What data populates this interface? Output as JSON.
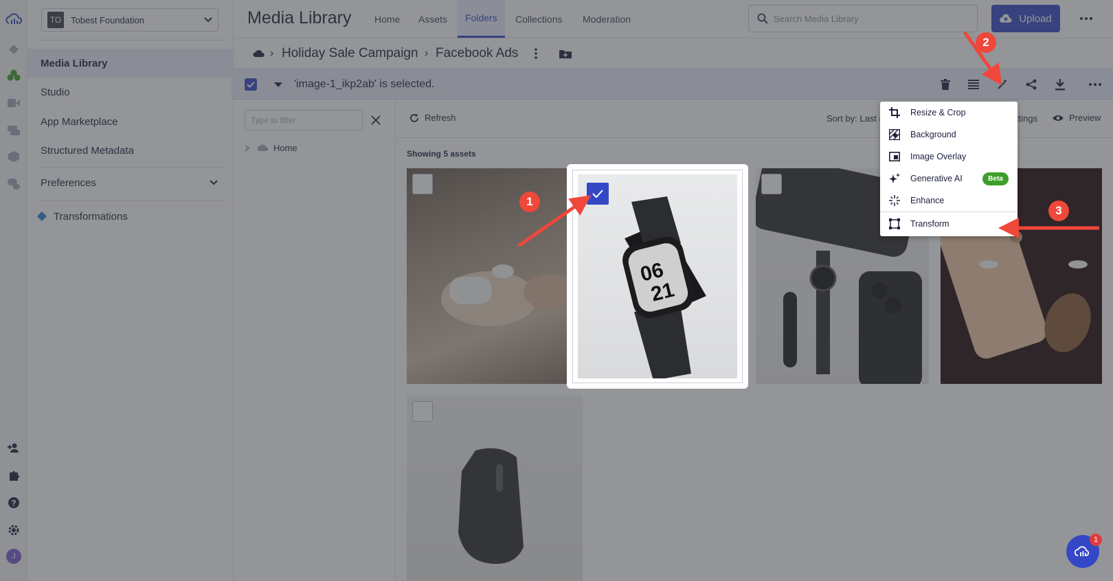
{
  "account": {
    "badge": "TO",
    "name": "Tobest Foundation"
  },
  "nav": {
    "items": [
      {
        "label": "Media Library"
      },
      {
        "label": "Studio"
      },
      {
        "label": "App Marketplace"
      },
      {
        "label": "Structured Metadata"
      },
      {
        "label": "Preferences"
      },
      {
        "label": "Transformations"
      }
    ]
  },
  "header": {
    "title": "Media Library",
    "tabs": [
      "Home",
      "Assets",
      "Folders",
      "Collections",
      "Moderation"
    ],
    "active_tab": "Folders",
    "search_placeholder": "Search Media Library",
    "upload_label": "Upload"
  },
  "breadcrumb": {
    "folder": "Holiday Sale Campaign",
    "subfolder": "Facebook Ads"
  },
  "selection": {
    "text": "'image-1_ikp2ab' is selected."
  },
  "filter": {
    "placeholder": "Type to filter",
    "tree_root": "Home"
  },
  "toolbar": {
    "refresh_label": "Refresh",
    "sort_label": "Sort by: Last m",
    "settings_label": "ttings",
    "preview_label": "Preview",
    "showing": "Showing 5 assets"
  },
  "menu": {
    "items": [
      {
        "label": "Resize & Crop",
        "icon": "crop-icon"
      },
      {
        "label": "Background",
        "icon": "background-icon"
      },
      {
        "label": "Image Overlay",
        "icon": "image-overlay-icon"
      },
      {
        "label": "Generative AI",
        "icon": "sparkle-icon",
        "badge": "Beta"
      },
      {
        "label": "Enhance",
        "icon": "enhance-icon"
      },
      {
        "label": "Transform",
        "icon": "transform-icon"
      }
    ]
  },
  "watch_face": {
    "line1": "06",
    "line2": "21"
  },
  "annotations": [
    "1",
    "2",
    "3"
  ],
  "user_initial": "J",
  "notification_count": "1",
  "colors": {
    "brand": "#3448c5",
    "annotation": "#f0473b",
    "beta": "#3e9e2b"
  }
}
